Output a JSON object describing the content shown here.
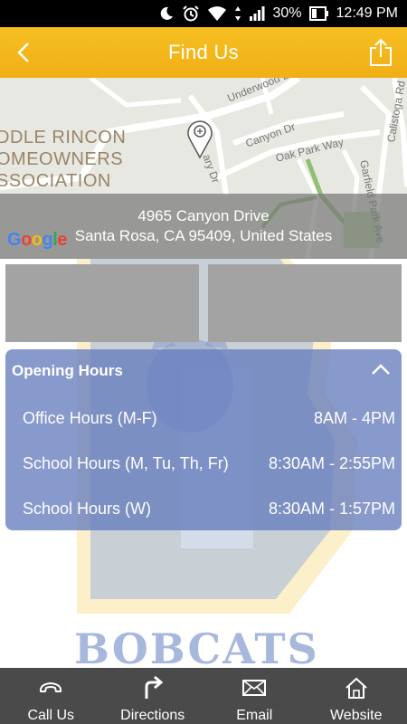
{
  "status_bar": {
    "battery": "30%",
    "time": "12:49 PM"
  },
  "header": {
    "title": "Find Us"
  },
  "map": {
    "streets": [
      "Underwood Dr",
      "Canyon Dr",
      "Oak Park Way",
      "Calistoga Rd",
      "Garfield Park Ave",
      "ary Dr"
    ],
    "association_lines": [
      "DDLE RINCON",
      "OMEOWNERS",
      "SSOCIATION"
    ],
    "address_line1": "4965 Canyon Drive",
    "address_line2": "Santa Rosa, CA 95409, United States",
    "google_logo": "Google"
  },
  "mascot": {
    "text": "BOBCATS"
  },
  "opening_hours": {
    "title": "Opening Hours",
    "rows": [
      {
        "label": "Office Hours (M-F)",
        "time": "8AM - 4PM"
      },
      {
        "label": "School Hours (M, Tu, Th, Fr)",
        "time": "8:30AM - 2:55PM"
      },
      {
        "label": "School Hours (W)",
        "time": "8:30AM - 1:57PM"
      }
    ]
  },
  "bottom_nav": [
    {
      "label": "Call Us",
      "icon": "phone-icon"
    },
    {
      "label": "Directions",
      "icon": "directions-icon"
    },
    {
      "label": "Email",
      "icon": "envelope-icon"
    },
    {
      "label": "Website",
      "icon": "house-icon"
    }
  ],
  "colors": {
    "accent": "#f2b418",
    "card": "#667cbe",
    "nav": "#4a4a4a"
  }
}
